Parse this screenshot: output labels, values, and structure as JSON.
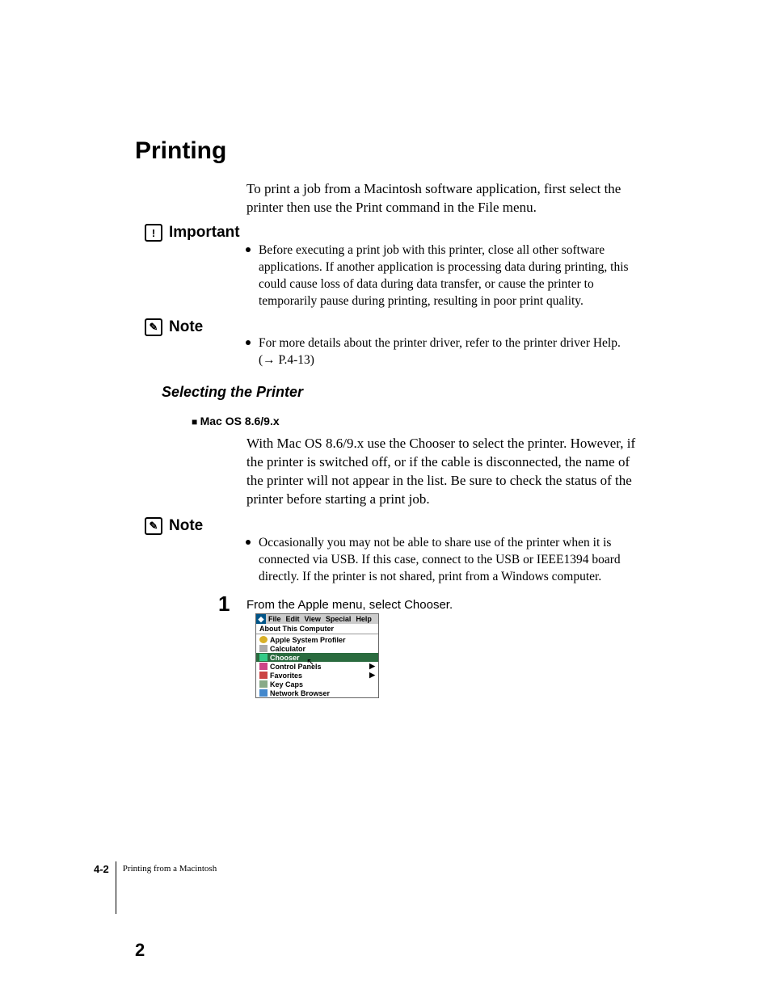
{
  "heading1": "Printing",
  "intro": "To print a job from a Macintosh software application, first select the printer then use the Print command in the File menu.",
  "callouts": {
    "important": "Important",
    "note": "Note"
  },
  "bullets": {
    "important1": "Before executing a print job with this printer, close all other software applications. If another application is processing data during printing, this could cause loss of data during data transfer, or cause the printer to temporarily pause during printing, resulting in poor print quality.",
    "note1_line": "For more details about the printer driver, refer to the printer driver Help.",
    "note1_ref": "(→ P.4-13)",
    "note2": "Occasionally you may not be able to share use of the printer when it is connected via USB. If this case, connect to the USB or IEEE1394 board directly. If the printer is not shared, print from a Windows computer."
  },
  "subheading": "Selecting the Printer",
  "subsub": "Mac OS 8.6/9.x",
  "body2": "With Mac OS 8.6/9.x use the Chooser to select the printer. However, if the printer is switched off, or if the cable is disconnected, the name of the printer will not appear in the list. Be sure to check the status of the printer before starting a print job.",
  "step": {
    "num": "1",
    "text": "From the Apple menu, select Chooser."
  },
  "applemenu": {
    "menubar": [
      "File",
      "Edit",
      "View",
      "Special",
      "Help"
    ],
    "items": [
      {
        "label": "About This Computer",
        "sep_after": true
      },
      {
        "label": "Apple System Profiler",
        "icon": "ic-gear"
      },
      {
        "label": "Calculator",
        "icon": "ic-calc"
      },
      {
        "label": "Chooser",
        "icon": "ic-ch",
        "selected": true
      },
      {
        "label": "Control Panels",
        "icon": "ic-cp",
        "arrow": true
      },
      {
        "label": "Favorites",
        "icon": "ic-fav",
        "arrow": true
      },
      {
        "label": "Key Caps",
        "icon": "ic-key"
      },
      {
        "label": "Network Browser",
        "icon": "ic-net"
      }
    ]
  },
  "footer": {
    "pagenum": "4-2",
    "chapter": "Printing from a Macintosh"
  },
  "bignum": "2"
}
